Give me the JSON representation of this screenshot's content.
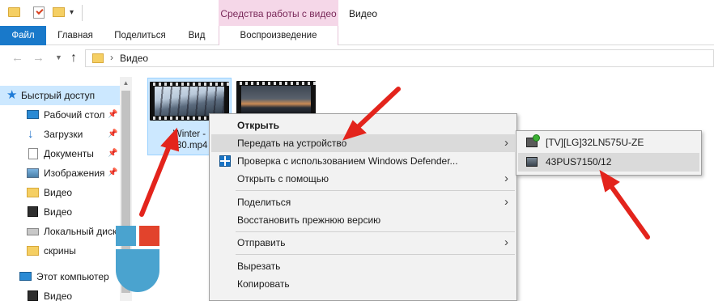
{
  "window": {
    "title": "Видео",
    "tools_header": "Средства работы с видео"
  },
  "quick_access_toolbar": {
    "dropdown_glyph": "▾"
  },
  "ribbon": {
    "tabs": [
      {
        "label": "Файл",
        "active": true
      },
      {
        "label": "Главная"
      },
      {
        "label": "Поделиться"
      },
      {
        "label": "Вид"
      },
      {
        "label": "Воспроизведение"
      }
    ],
    "file_tab_color": "#1979ca",
    "tools_color": "#f5d7e8"
  },
  "address_bar": {
    "separator": "›",
    "path": "Видео"
  },
  "navigation": {
    "items": [
      {
        "label": "Быстрый доступ",
        "icon": "star-icon",
        "selected": true
      },
      {
        "label": "Рабочий стол",
        "icon": "desktop-icon",
        "pinned": true
      },
      {
        "label": "Загрузки",
        "icon": "download-icon",
        "pinned": true
      },
      {
        "label": "Документы",
        "icon": "documents-icon",
        "pinned": true
      },
      {
        "label": "Изображения",
        "icon": "pictures-icon",
        "pinned": true
      },
      {
        "label": "Видео",
        "icon": "folder-icon"
      },
      {
        "label": "Видео",
        "icon": "videos-icon"
      },
      {
        "label": "Локальный диск",
        "icon": "disk-icon"
      },
      {
        "label": "скрины",
        "icon": "folder-icon"
      },
      {
        "label": "Этот компьютер",
        "icon": "computer-icon"
      },
      {
        "label": "Видео",
        "icon": "videos-icon"
      }
    ]
  },
  "files": [
    {
      "name_line1": "Winter -",
      "name_line2": "230.mp4",
      "selected": true
    },
    {
      "name_line1": "",
      "name_line2": "",
      "selected": false
    }
  ],
  "context_menu": {
    "items": [
      {
        "label": "Открыть",
        "bold": true
      },
      {
        "label": "Передать на устройство",
        "submenu": true,
        "hover": true
      },
      {
        "label": "Проверка с использованием Windows Defender...",
        "icon": "windows-defender-icon"
      },
      {
        "label": "Открыть с помощью",
        "submenu": true
      },
      {
        "label": "Поделиться",
        "submenu": true
      },
      {
        "label": "Восстановить прежнюю версию"
      },
      {
        "label": "Отправить",
        "submenu": true
      },
      {
        "label": "Вырезать"
      },
      {
        "label": "Копировать"
      }
    ],
    "submenu_glyph": "›"
  },
  "cast_submenu": {
    "devices": [
      {
        "label": "[TV][LG]32LN575U-ZE",
        "icon": "tv-connected-icon"
      },
      {
        "label": "43PUS7150/12",
        "icon": "tv-icon",
        "hover": true
      }
    ]
  },
  "annotation_colors": {
    "arrow": "#e3241c",
    "mouse_blue": "#4aa3cf",
    "mouse_red": "#e2432c"
  }
}
